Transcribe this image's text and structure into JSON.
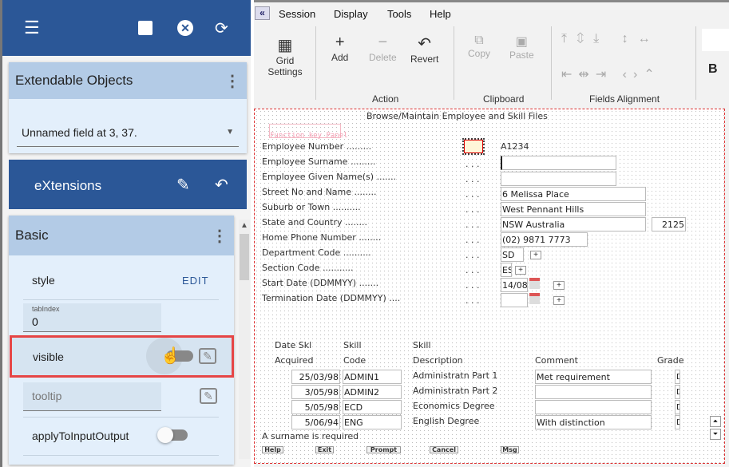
{
  "left": {
    "extendable_title": "Extendable Objects",
    "selected_field": "Unnamed field at 3, 37.",
    "extensions_title": "eXtensions",
    "basic_title": "Basic",
    "style_label": "style",
    "style_edit": "EDIT",
    "tabindex_label": "tabIndex",
    "tabindex_value": "0",
    "visible_label": "visible",
    "tooltip_placeholder": "tooltip",
    "apply_label": "applyToInputOutput"
  },
  "menu": [
    "Session",
    "Display",
    "Tools",
    "Help"
  ],
  "toolbar": {
    "grid": "Grid Settings",
    "add": "Add",
    "delete": "Delete",
    "revert": "Revert",
    "copy": "Copy",
    "paste": "Paste",
    "group_action": "Action",
    "group_clipboard": "Clipboard",
    "group_align": "Fields Alignment",
    "bold": "B"
  },
  "form": {
    "title": "Browse/Maintain Employee and Skill Files",
    "fkpanel": "Function key Panel",
    "labels": [
      "Employee Number .........",
      "Employee Surname .........",
      "Employee Given Name(s) .......",
      "Street No and Name ........",
      "Suburb or Town ..........",
      "State and Country ........",
      "Home Phone Number ........",
      "Department Code ..........",
      "Section Code ...........",
      "Start Date (DDMMYY) .......",
      "Termination Date (DDMMYY) ...."
    ],
    "dots": ". . .",
    "emp_number": "A1234",
    "surname": "",
    "given": "",
    "street": "6 Melissa Place",
    "suburb": "West Pennant Hills",
    "state": "NSW Australia",
    "postcode": "2125",
    "phone": "(02) 9871 7773",
    "dept": "SD",
    "section": "ES",
    "start": "14/08",
    "term": "",
    "plus": "+",
    "headers": {
      "date1": "Date Skl",
      "date2": "Acquired",
      "code1": "Skill",
      "code2": "Code",
      "desc1": "Skill",
      "desc2": "Description",
      "comment": "Comment",
      "grade": "Grade"
    },
    "rows": [
      {
        "date": "25/03/98",
        "code": "ADMIN1",
        "desc": "Administratn Part 1",
        "comment": "Met requirement",
        "grade": "D"
      },
      {
        "date": "3/05/98",
        "code": "ADMIN2",
        "desc": "Administratn Part 2",
        "comment": "",
        "grade": "D"
      },
      {
        "date": "5/05/98",
        "code": "ECD",
        "desc": "Economics Degree",
        "comment": "",
        "grade": "D"
      },
      {
        "date": "5/06/94",
        "code": "ENG",
        "desc": "English Degree",
        "comment": "With distinction",
        "grade": "D"
      }
    ],
    "message": "A surname is required",
    "fkeys": [
      "Help",
      "Exit",
      "Prompt",
      "Cancel",
      "Msg"
    ]
  }
}
